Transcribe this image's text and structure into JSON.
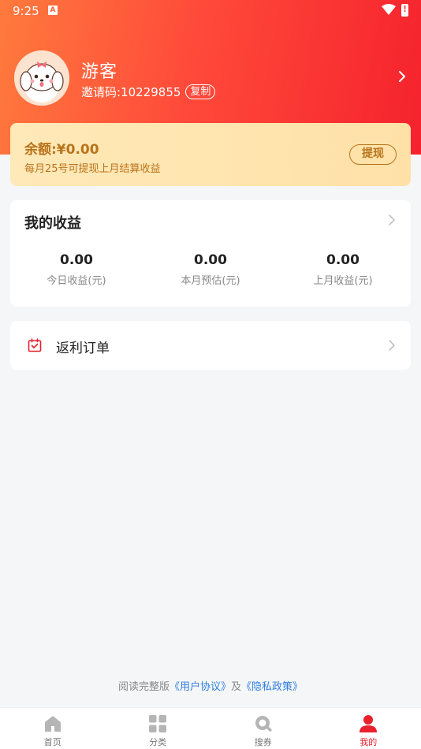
{
  "status_bar": {
    "time": "9:25",
    "notification_letter": "A"
  },
  "profile": {
    "username": "游客",
    "invite_label": "邀请码:",
    "invite_code": "10229855",
    "copy_label": "复制"
  },
  "balance": {
    "label": "余额:¥0.00",
    "note": "每月25号可提现上月结算收益",
    "withdraw_label": "提现"
  },
  "earnings": {
    "title": "我的收益",
    "stats": [
      {
        "value": "0.00",
        "label": "今日收益(元)"
      },
      {
        "value": "0.00",
        "label": "本月预估(元)"
      },
      {
        "value": "0.00",
        "label": "上月收益(元)"
      }
    ]
  },
  "orders": {
    "label": "返利订单",
    "icon": "order-check-icon"
  },
  "footer": {
    "prefix": "阅读完整版",
    "user_agreement": "《用户协议》",
    "conjunction": "及",
    "privacy_policy": "《隐私政策》"
  },
  "tabbar": {
    "active": "mine",
    "active_color": "#e8212c",
    "tabs": [
      {
        "key": "home",
        "label": "首页",
        "icon": "home-icon"
      },
      {
        "key": "category",
        "label": "分类",
        "icon": "grid-icon"
      },
      {
        "key": "search",
        "label": "搜券",
        "icon": "search-icon"
      },
      {
        "key": "mine",
        "label": "我的",
        "icon": "user-icon"
      }
    ]
  }
}
